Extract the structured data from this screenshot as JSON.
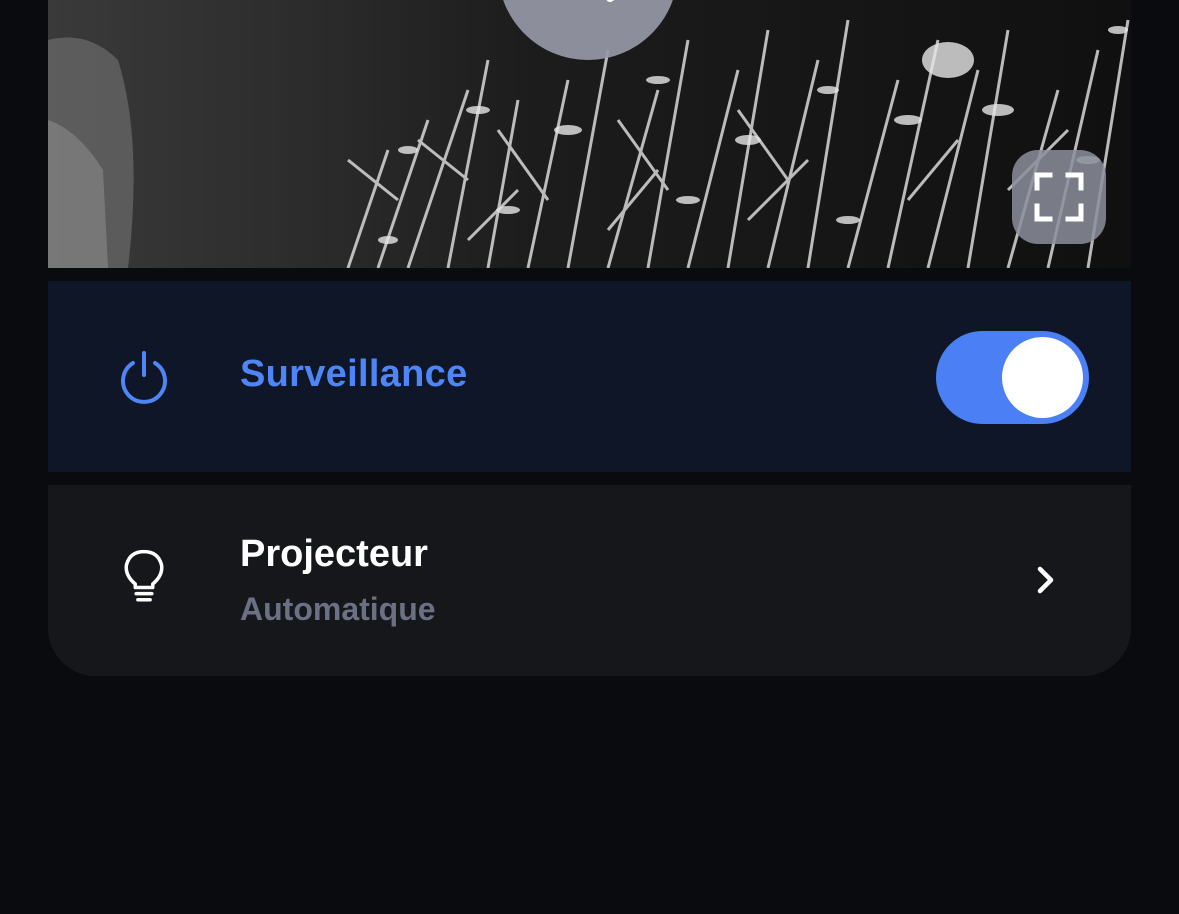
{
  "camera": {
    "play_icon": "play-icon",
    "fullscreen_icon": "fullscreen-icon"
  },
  "surveillance": {
    "icon": "power-icon",
    "label": "Surveillance",
    "enabled": true,
    "accent": "#4f86f7"
  },
  "projecteur": {
    "icon": "lightbulb-icon",
    "label": "Projecteur",
    "value": "Automatique",
    "chevron": "chevron-right-icon"
  }
}
